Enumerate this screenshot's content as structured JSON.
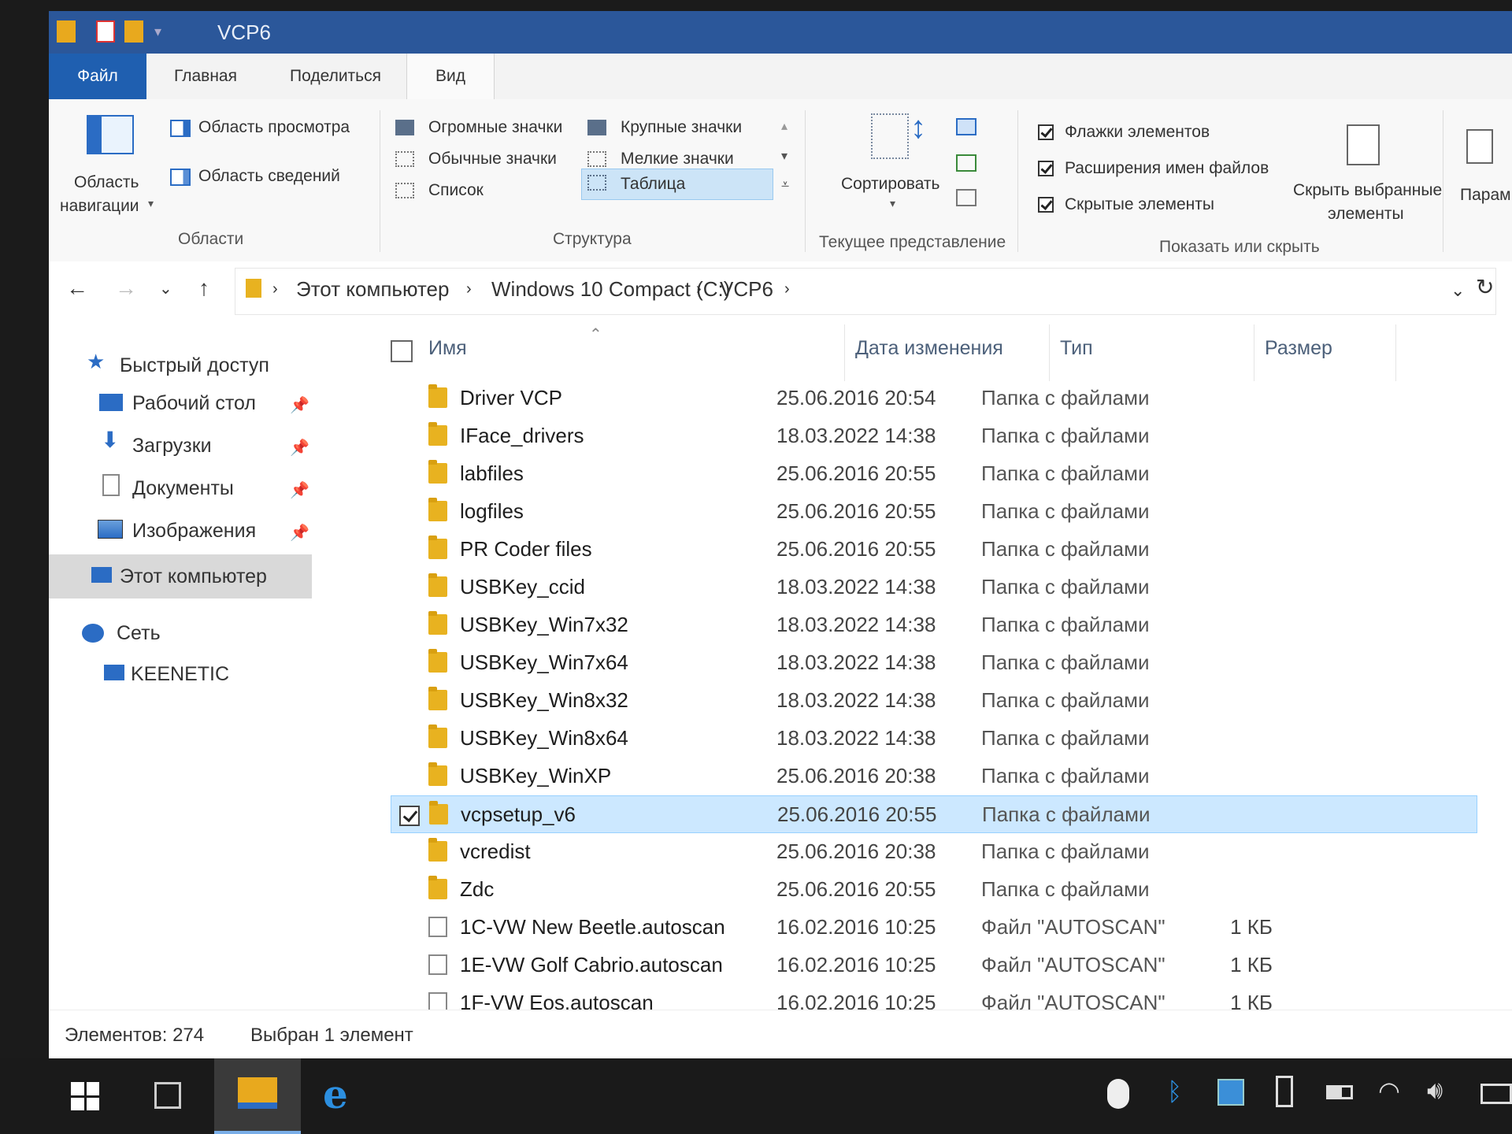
{
  "window": {
    "title": "VCP6"
  },
  "ribbon": {
    "tabs": [
      "Файл",
      "Главная",
      "Поделиться",
      "Вид"
    ],
    "panes_group": {
      "nav_pane_line1": "Область",
      "nav_pane_line2": "навигации",
      "preview_pane": "Область просмотра",
      "details_pane": "Область сведений",
      "group_label": "Области"
    },
    "layout_group": {
      "items": [
        "Огромные значки",
        "Крупные значки",
        "Обычные значки",
        "Мелкие значки",
        "Список",
        "Таблица"
      ],
      "selected": "Таблица",
      "group_label": "Структура"
    },
    "current_view_group": {
      "sort_label": "Сортировать",
      "group_label": "Текущее представление"
    },
    "show_hide_group": {
      "item_checkboxes": "Флажки элементов",
      "file_extensions": "Расширения имен файлов",
      "hidden_items": "Скрытые элементы",
      "hide_selected_line1": "Скрыть выбранные",
      "hide_selected_line2": "элементы",
      "group_label": "Показать или скрыть"
    },
    "options_label": "Парам"
  },
  "address": {
    "breadcrumbs": [
      "Этот компьютер",
      "Windows 10 Compact (C:)",
      "VCP6"
    ]
  },
  "nav": {
    "quick_access": "Быстрый доступ",
    "desktop": "Рабочий стол",
    "downloads": "Загрузки",
    "documents": "Документы",
    "pictures": "Изображения",
    "this_pc": "Этот компьютер",
    "network": "Сеть",
    "keenetic": "KEENETIC"
  },
  "columns": {
    "name": "Имя",
    "date": "Дата изменения",
    "type": "Тип",
    "size": "Размер"
  },
  "files": [
    {
      "name": "Driver VCP",
      "date": "25.06.2016 20:54",
      "type": "Папка с файлами",
      "size": "",
      "kind": "folder",
      "selected": false
    },
    {
      "name": "IFace_drivers",
      "date": "18.03.2022 14:38",
      "type": "Папка с файлами",
      "size": "",
      "kind": "folder",
      "selected": false
    },
    {
      "name": "labfiles",
      "date": "25.06.2016 20:55",
      "type": "Папка с файлами",
      "size": "",
      "kind": "folder",
      "selected": false
    },
    {
      "name": "logfiles",
      "date": "25.06.2016 20:55",
      "type": "Папка с файлами",
      "size": "",
      "kind": "folder",
      "selected": false
    },
    {
      "name": "PR Coder files",
      "date": "25.06.2016 20:55",
      "type": "Папка с файлами",
      "size": "",
      "kind": "folder",
      "selected": false
    },
    {
      "name": "USBKey_ccid",
      "date": "18.03.2022 14:38",
      "type": "Папка с файлами",
      "size": "",
      "kind": "folder",
      "selected": false
    },
    {
      "name": "USBKey_Win7x32",
      "date": "18.03.2022 14:38",
      "type": "Папка с файлами",
      "size": "",
      "kind": "folder",
      "selected": false
    },
    {
      "name": "USBKey_Win7x64",
      "date": "18.03.2022 14:38",
      "type": "Папка с файлами",
      "size": "",
      "kind": "folder",
      "selected": false
    },
    {
      "name": "USBKey_Win8x32",
      "date": "18.03.2022 14:38",
      "type": "Папка с файлами",
      "size": "",
      "kind": "folder",
      "selected": false
    },
    {
      "name": "USBKey_Win8x64",
      "date": "18.03.2022 14:38",
      "type": "Папка с файлами",
      "size": "",
      "kind": "folder",
      "selected": false
    },
    {
      "name": "USBKey_WinXP",
      "date": "25.06.2016 20:38",
      "type": "Папка с файлами",
      "size": "",
      "kind": "folder",
      "selected": false
    },
    {
      "name": "vcpsetup_v6",
      "date": "25.06.2016 20:55",
      "type": "Папка с файлами",
      "size": "",
      "kind": "folder",
      "selected": true
    },
    {
      "name": "vcredist",
      "date": "25.06.2016 20:38",
      "type": "Папка с файлами",
      "size": "",
      "kind": "folder",
      "selected": false
    },
    {
      "name": "Zdc",
      "date": "25.06.2016 20:55",
      "type": "Папка с файлами",
      "size": "",
      "kind": "folder",
      "selected": false
    },
    {
      "name": "1C-VW New Beetle.autoscan",
      "date": "16.02.2016 10:25",
      "type": "Файл \"AUTOSCAN\"",
      "size": "1 КБ",
      "kind": "file",
      "selected": false
    },
    {
      "name": "1E-VW Golf Cabrio.autoscan",
      "date": "16.02.2016 10:25",
      "type": "Файл \"AUTOSCAN\"",
      "size": "1 КБ",
      "kind": "file",
      "selected": false
    },
    {
      "name": "1F-VW Eos.autoscan",
      "date": "16.02.2016 10:25",
      "type": "Файл \"AUTOSCAN\"",
      "size": "1 КБ",
      "kind": "file",
      "selected": false
    }
  ],
  "status": {
    "count": "Элементов: 274",
    "selected": "Выбран 1 элемент"
  },
  "colors": {
    "title_bar": "#2b579a",
    "file_tab": "#1f5fb0",
    "selection": "#cce8ff",
    "folder": "#e8b220",
    "taskbar": "#1a1a1a"
  }
}
